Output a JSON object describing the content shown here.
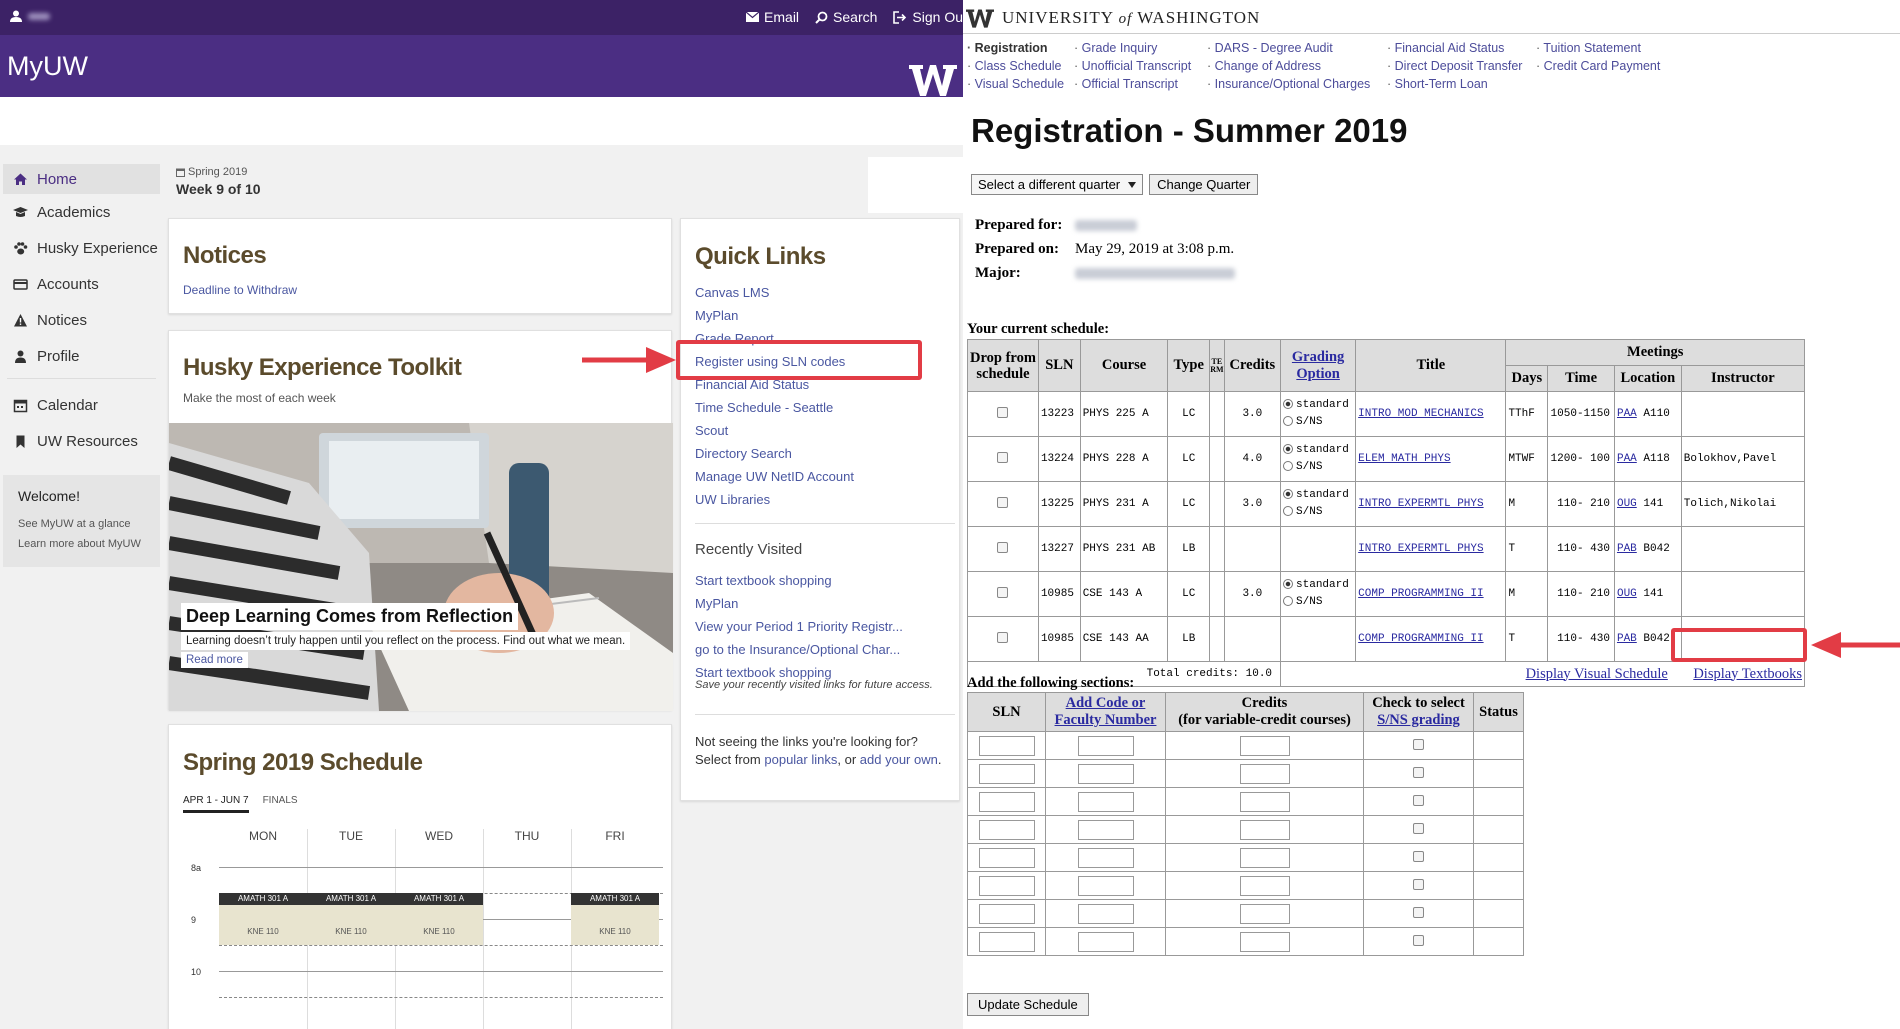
{
  "myuw": {
    "topbar": {
      "user_icon": "person-icon",
      "links": [
        {
          "icon": "envelope-icon",
          "label": "Email"
        },
        {
          "icon": "search-icon",
          "label": "Search"
        },
        {
          "icon": "sign-out-icon",
          "label": "Sign Ou"
        }
      ]
    },
    "brand": "MyUW",
    "nav": [
      {
        "icon": "home-icon",
        "label": "Home",
        "active": true
      },
      {
        "icon": "graduation-cap-icon",
        "label": "Academics"
      },
      {
        "icon": "paw-icon",
        "label": "Husky Experience"
      },
      {
        "icon": "credit-card-icon",
        "label": "Accounts"
      },
      {
        "icon": "warning-icon",
        "label": "Notices"
      },
      {
        "icon": "person-icon",
        "label": "Profile"
      },
      {
        "icon": "calendar-icon",
        "label": "Calendar"
      },
      {
        "icon": "bookmark-icon",
        "label": "UW Resources"
      }
    ],
    "welcome": {
      "title": "Welcome!",
      "links": [
        "See MyUW at a glance",
        "Learn more about MyUW"
      ]
    },
    "term": {
      "quarter": "Spring 2019",
      "week": "Week 9 of 10"
    },
    "notices": {
      "title": "Notices",
      "link": "Deadline to Withdraw"
    },
    "toolkit": {
      "title": "Husky Experience Toolkit",
      "subtitle": "Make the most of each week",
      "caption_title": "Deep Learning Comes from Reflection",
      "caption_text": "Learning doesn’t truly happen until you reflect on the process. Find out what we mean.",
      "read_more": "Read more"
    },
    "schedule": {
      "title": "Spring 2019 Schedule",
      "tabs": [
        "APR 1 - JUN 7",
        "FINALS"
      ],
      "days": [
        "MON",
        "TUE",
        "WED",
        "THU",
        "FRI"
      ],
      "hours": [
        "8a",
        "9",
        "10"
      ],
      "events": [
        {
          "day": "MON",
          "course": "AMATH 301 A",
          "room": "KNE 110"
        },
        {
          "day": "TUE",
          "course": "AMATH 301 A",
          "room": "KNE 110"
        },
        {
          "day": "WED",
          "course": "AMATH 301 A",
          "room": "KNE 110"
        },
        {
          "day": "FRI",
          "course": "AMATH 301 A",
          "room": "KNE 110"
        }
      ]
    },
    "quick_links": {
      "title": "Quick Links",
      "links": [
        "Canvas LMS",
        "MyPlan",
        "Grade Report",
        "Register using SLN codes",
        "Financial Aid Status",
        "Time Schedule - Seattle",
        "Scout",
        "Directory Search",
        "Manage UW NetID Account",
        "UW Libraries"
      ],
      "recent_title": "Recently Visited",
      "recent": [
        "Start textbook shopping",
        "MyPlan",
        "View your Period 1 Priority Registr...",
        "go to the Insurance/Optional Char...",
        "Start textbook shopping"
      ],
      "recent_note": "Save your recently visited links for future access.",
      "more_text": "Not seeing the links you're looking for? Select from",
      "more_link1": "popular links",
      "more_or": ", or",
      "more_link2": "add your own",
      "more_end": "."
    }
  },
  "registration": {
    "header": {
      "university": "UNIVERSITY",
      "of": "of",
      "washington": "WASHINGTON"
    },
    "subnav": [
      [
        "Registration",
        "Class Schedule",
        "Visual Schedule"
      ],
      [
        "Grade Inquiry",
        "Unofficial Transcript",
        "Official Transcript"
      ],
      [
        "DARS - Degree Audit",
        "Change of Address",
        "Insurance/Optional Charges"
      ],
      [
        "Financial Aid Status",
        "Direct Deposit Transfer",
        "Short-Term Loan"
      ],
      [
        "Tuition Statement",
        "Credit Card Payment"
      ]
    ],
    "title": "Registration - Summer 2019",
    "quarter_select": "Select a different quarter",
    "change_quarter": "Change Quarter",
    "prepared_for_label": "Prepared for:",
    "prepared_on_label": "Prepared on:",
    "prepared_on": "May 29, 2019 at 3:08 p.m.",
    "major_label": "Major:",
    "current_label": "Your current schedule:",
    "columns": {
      "drop": "Drop from schedule",
      "sln": "SLN",
      "course": "Course",
      "type": "Type",
      "term": "TERM",
      "credits": "Credits",
      "grading": "Grading Option",
      "title": "Title",
      "meetings": "Meetings",
      "days": "Days",
      "time": "Time",
      "location": "Location",
      "instructor": "Instructor"
    },
    "grading_standard": "standard",
    "grading_sns": "S/NS",
    "rows": [
      {
        "sln": "13223",
        "course": "PHYS 225 A",
        "type": "LC",
        "credits": "3.0",
        "grading": true,
        "title": "INTRO MOD MECHANICS",
        "days": "TThF",
        "time": "1050-1150",
        "bldg": "PAA",
        "room": "A110",
        "instructor": ""
      },
      {
        "sln": "13224",
        "course": "PHYS 228 A",
        "type": "LC",
        "credits": "4.0",
        "grading": true,
        "title": "ELEM MATH PHYS",
        "days": "MTWF",
        "time": "1200- 100",
        "bldg": "PAA",
        "room": "A118",
        "instructor": "Bolokhov,Pavel"
      },
      {
        "sln": "13225",
        "course": "PHYS 231 A",
        "type": "LC",
        "credits": "3.0",
        "grading": true,
        "title": "INTRO EXPERMTL PHYS",
        "days": "M",
        "time": "110- 210",
        "bldg": "OUG",
        "room": "141",
        "instructor": "Tolich,Nikolai"
      },
      {
        "sln": "13227",
        "course": "PHYS 231 AB",
        "type": "LB",
        "credits": "",
        "grading": false,
        "title": "INTRO EXPERMTL PHYS",
        "days": "T",
        "time": "110- 430",
        "bldg": "PAB",
        "room": "B042",
        "instructor": ""
      },
      {
        "sln": "10985",
        "course": "CSE 143 A",
        "type": "LC",
        "credits": "3.0",
        "grading": true,
        "title": "COMP PROGRAMMING II",
        "days": "M",
        "time": "110- 210",
        "bldg": "OUG",
        "room": "141",
        "instructor": ""
      },
      {
        "sln": "10985",
        "course": "CSE 143 AA",
        "type": "LB",
        "credits": "",
        "grading": false,
        "title": "COMP PROGRAMMING II",
        "days": "T",
        "time": "110- 430",
        "bldg": "PAB",
        "room": "B042",
        "instructor": ""
      }
    ],
    "total_credits": "Total credits: 10.0",
    "display_visual": "Display Visual Schedule",
    "display_textbooks": "Display Textbooks",
    "add_label": "Add the following sections:",
    "add_columns": {
      "sln": "SLN",
      "add_code": "Add Code or Faculty Number",
      "credits": "Credits",
      "credits_sub": "(for variable-credit courses)",
      "check": "Check to select",
      "check_link": "S/NS grading",
      "status": "Status"
    },
    "add_rows": 8,
    "update_button": "Update Schedule"
  },
  "annotations": {
    "highlight_color": "#e23c45"
  },
  "colors": {
    "myuw_purple": "#4b2e83",
    "myuw_topbar": "#3c2266",
    "link": "#4a57a1"
  }
}
